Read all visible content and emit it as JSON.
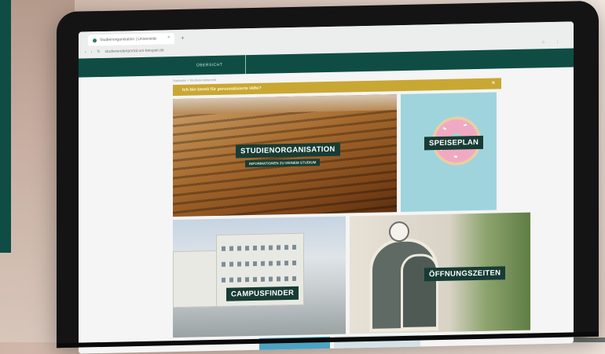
{
  "browser": {
    "tab_title": "Studienorganisation | Universität",
    "tab_close": "×",
    "new_tab": "+",
    "url": "studierendenportal.uni-beispiel.de",
    "toolbar_icons": "☆ ⋮"
  },
  "site": {
    "nav_item": "ÜBERSICHT",
    "breadcrumb": "Startseite  >  Studierendenportal",
    "alert_text": "Ich bin bereit für personalisierte Hilfe?",
    "alert_close": "×"
  },
  "tiles": [
    {
      "title": "STUDIENORGANISATION",
      "subtitle": "INFORMATIONEN ZU DEINEM STUDIUM"
    },
    {
      "title": "SPEISEPLAN"
    },
    {
      "title": "CAMPUSFINDER"
    },
    {
      "title": "ÖFFNUNGSZEITEN"
    }
  ],
  "colors": {
    "brand_green": "#0f4d44",
    "label_bg": "#173c34",
    "alert_gold": "#c9a733"
  }
}
